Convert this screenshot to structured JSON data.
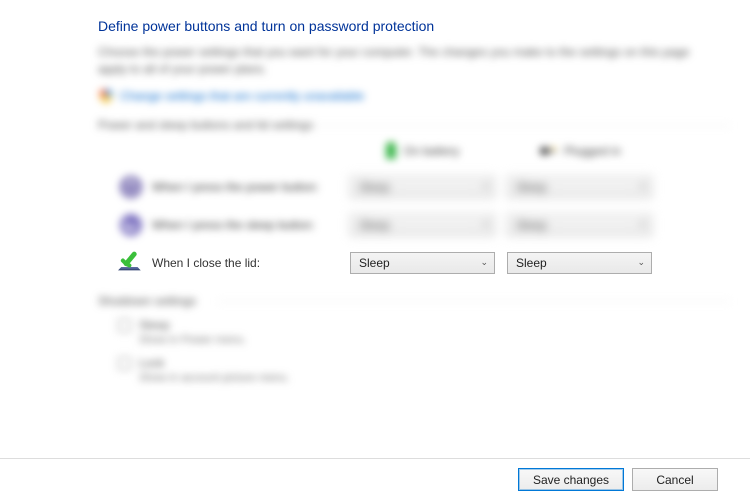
{
  "title": "Define power buttons and turn on password protection",
  "description": "Choose the power settings that you want for your computer. The changes you make to the settings on this page apply to all of your power plans.",
  "admin_link": "Change settings that are currently unavailable",
  "section1_label": "Power and sleep buttons and lid settings",
  "columns": {
    "battery": "On battery",
    "plugged": "Plugged in"
  },
  "rows": {
    "power_button": {
      "label": "When I press the power button:",
      "battery": "Sleep",
      "plugged": "Sleep"
    },
    "sleep_button": {
      "label": "When I press the sleep button:",
      "battery": "Sleep",
      "plugged": "Sleep"
    },
    "close_lid": {
      "label": "When I close the lid:",
      "battery": "Sleep",
      "plugged": "Sleep"
    }
  },
  "shutdown": {
    "label": "Shutdown settings",
    "items": [
      {
        "title": "Sleep",
        "sub": "Show in Power menu."
      },
      {
        "title": "Lock",
        "sub": "Show in account picture menu."
      }
    ]
  },
  "footer": {
    "save": "Save changes",
    "cancel": "Cancel"
  }
}
